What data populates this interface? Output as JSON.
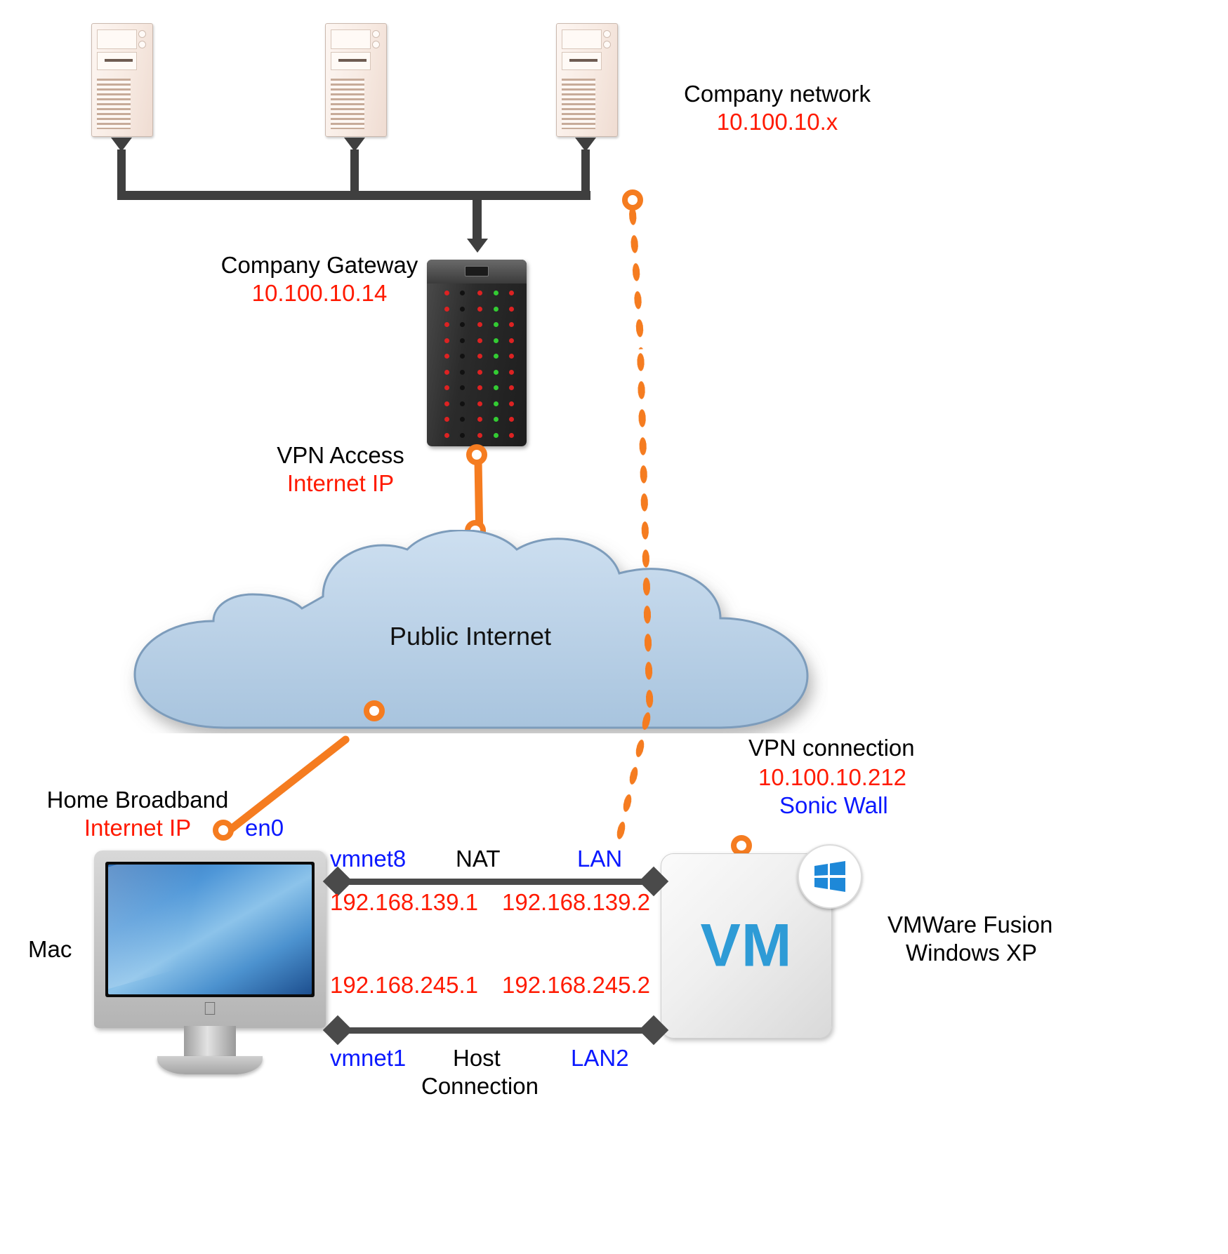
{
  "diagram": {
    "title": "Mac / VMware Fusion VPN network topology",
    "colors": {
      "accent_orange": "#f57c20",
      "ip_red": "#ff1a00",
      "label_blue": "#0a18ff",
      "bus_gray": "#3f3f3f",
      "cloud_blue": "#bcd3e8"
    }
  },
  "labels": {
    "company_network_title": "Company network",
    "company_network_ip": "10.100.10.x",
    "company_gateway_title": "Company Gateway",
    "company_gateway_ip": "10.100.10.14",
    "vpn_access_title": "VPN Access",
    "vpn_access_ip": "Internet IP",
    "cloud": "Public Internet",
    "vpn_connection_title": "VPN connection",
    "vpn_connection_ip": "10.100.10.212",
    "vpn_connection_device": "Sonic Wall",
    "home_broadband_title": "Home Broadband",
    "home_broadband_ip": "Internet IP",
    "en0": "en0",
    "mac": "Mac",
    "vmware_line1": "VMWare Fusion",
    "vmware_line2": "Windows XP",
    "vm_text": "VM",
    "nat_left_iface": "vmnet8",
    "nat_title": "NAT",
    "nat_right_iface": "LAN",
    "nat_left_ip": "192.168.139.1",
    "nat_right_ip": "192.168.139.2",
    "host_left_ip": "192.168.245.1",
    "host_right_ip": "192.168.245.2",
    "host_left_iface": "vmnet1",
    "host_title_line1": "Host",
    "host_title_line2": "Connection",
    "host_right_iface": "LAN2"
  },
  "nodes": {
    "servers": [
      {
        "name": "server-1"
      },
      {
        "name": "server-2"
      },
      {
        "name": "server-3"
      }
    ]
  }
}
